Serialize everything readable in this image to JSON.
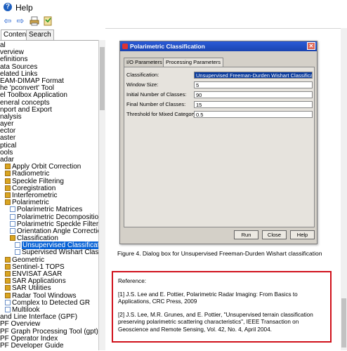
{
  "window": {
    "title": "Help"
  },
  "toolbar": {
    "icons": [
      "back-arrow-icon",
      "forward-arrow-icon",
      "print-icon",
      "options-icon"
    ]
  },
  "left_tabs": {
    "contents": "Contents",
    "search": "Search"
  },
  "tree": [
    {
      "label": "al",
      "icon": "page",
      "indent": 0
    },
    {
      "label": "verview",
      "icon": "page",
      "indent": 0
    },
    {
      "label": "efinitions",
      "icon": "page",
      "indent": 0
    },
    {
      "label": "ata Sources",
      "icon": "page",
      "indent": 0
    },
    {
      "label": "elated Links",
      "icon": "page",
      "indent": 0
    },
    {
      "label": "EAM-DIMAP Format",
      "icon": "page",
      "indent": 0
    },
    {
      "label": "he 'pconvert' Tool",
      "icon": "page",
      "indent": 0
    },
    {
      "label": "el Toolbox Application",
      "icon": "page",
      "indent": 0
    },
    {
      "label": "eneral concepts",
      "icon": "page",
      "indent": 0
    },
    {
      "label": "nport and Export",
      "icon": "page",
      "indent": 0
    },
    {
      "label": "nalysis",
      "icon": "page",
      "indent": 0
    },
    {
      "label": "ayer",
      "icon": "page",
      "indent": 0
    },
    {
      "label": "ector",
      "icon": "page",
      "indent": 0
    },
    {
      "label": "aster",
      "icon": "page",
      "indent": 0
    },
    {
      "label": "ptical",
      "icon": "page",
      "indent": 0
    },
    {
      "label": "ools",
      "icon": "page",
      "indent": 0
    },
    {
      "label": "adar",
      "icon": "page",
      "indent": 0
    },
    {
      "label": "Apply Orbit Correction",
      "icon": "book",
      "indent": 1
    },
    {
      "label": "Radiometric",
      "icon": "book",
      "indent": 1
    },
    {
      "label": "Speckle Filtering",
      "icon": "book",
      "indent": 1
    },
    {
      "label": "Coregistration",
      "icon": "book",
      "indent": 1
    },
    {
      "label": "Interferometric",
      "icon": "book",
      "indent": 1
    },
    {
      "label": "Polarimetric",
      "icon": "book",
      "indent": 1
    },
    {
      "label": "Polarimetric Matrices",
      "icon": "page",
      "indent": 2
    },
    {
      "label": "Polarimetric Decomposition",
      "icon": "page",
      "indent": 2
    },
    {
      "label": "Polarimetric Speckle Filtering",
      "icon": "page",
      "indent": 2
    },
    {
      "label": "Orientation Angle Correction",
      "icon": "page",
      "indent": 2
    },
    {
      "label": "Classification",
      "icon": "book",
      "indent": 2
    },
    {
      "label": "Unsupervised Classification",
      "icon": "page",
      "indent": 3,
      "selected": true
    },
    {
      "label": "Supervised Wishart Classification",
      "icon": "page",
      "indent": 3
    },
    {
      "label": "Geometric",
      "icon": "book",
      "indent": 1
    },
    {
      "label": "Sentinel-1 TOPS",
      "icon": "book",
      "indent": 1
    },
    {
      "label": "ENVISAT ASAR",
      "icon": "book",
      "indent": 1
    },
    {
      "label": "SAR Applications",
      "icon": "book",
      "indent": 1
    },
    {
      "label": "SAR Utilities",
      "icon": "book",
      "indent": 1
    },
    {
      "label": "Radar Tool Windows",
      "icon": "book",
      "indent": 1
    },
    {
      "label": "Complex to Detected GR",
      "icon": "page",
      "indent": 1
    },
    {
      "label": "Multilook",
      "icon": "page",
      "indent": 1
    },
    {
      "label": "and Line Interface (GPF)",
      "icon": "page",
      "indent": 0
    },
    {
      "label": "PF Overview",
      "icon": "page",
      "indent": 0
    },
    {
      "label": "PF Graph Processing Tool (gpt)",
      "icon": "page",
      "indent": 0
    },
    {
      "label": "PF Operator Index",
      "icon": "page",
      "indent": 0
    },
    {
      "label": "PF Developer Guide",
      "icon": "page",
      "indent": 0
    }
  ],
  "dialog": {
    "title": "Polarimetric Classification",
    "tabs": [
      "I/O Parameters",
      "Processing Parameters"
    ],
    "fields": [
      {
        "label": "Classification:",
        "value": "Unsupervised Freeman-Durden Wishart Classification",
        "highlight": true
      },
      {
        "label": "Window Size:",
        "value": "5"
      },
      {
        "label": "Initial Number of Classes:",
        "value": "90"
      },
      {
        "label": "Final Number of Classes:",
        "value": "15"
      },
      {
        "label": "Threshold for Mixed Category:",
        "value": "0.5"
      }
    ],
    "buttons": {
      "run": "Run",
      "close": "Close",
      "help": "Help"
    }
  },
  "caption": "Figure 4. Dialog box for Unsupervised Freeman-Durden Wishart classification",
  "reference": {
    "heading": "Reference:",
    "items": [
      "[1] J.S. Lee and E. Pottier, Polarimetric Radar Imaging: From Basics to Applications, CRC Press, 2009",
      "[2] J.S. Lee, M.R. Grunes, and E. Pottier, \"Unsupervised terrain classification preserving polarimetric scattering characteristics\", IEEE Transaction on Geoscience and Remote Sensing, Vol. 42, No. 4, April 2004."
    ]
  }
}
